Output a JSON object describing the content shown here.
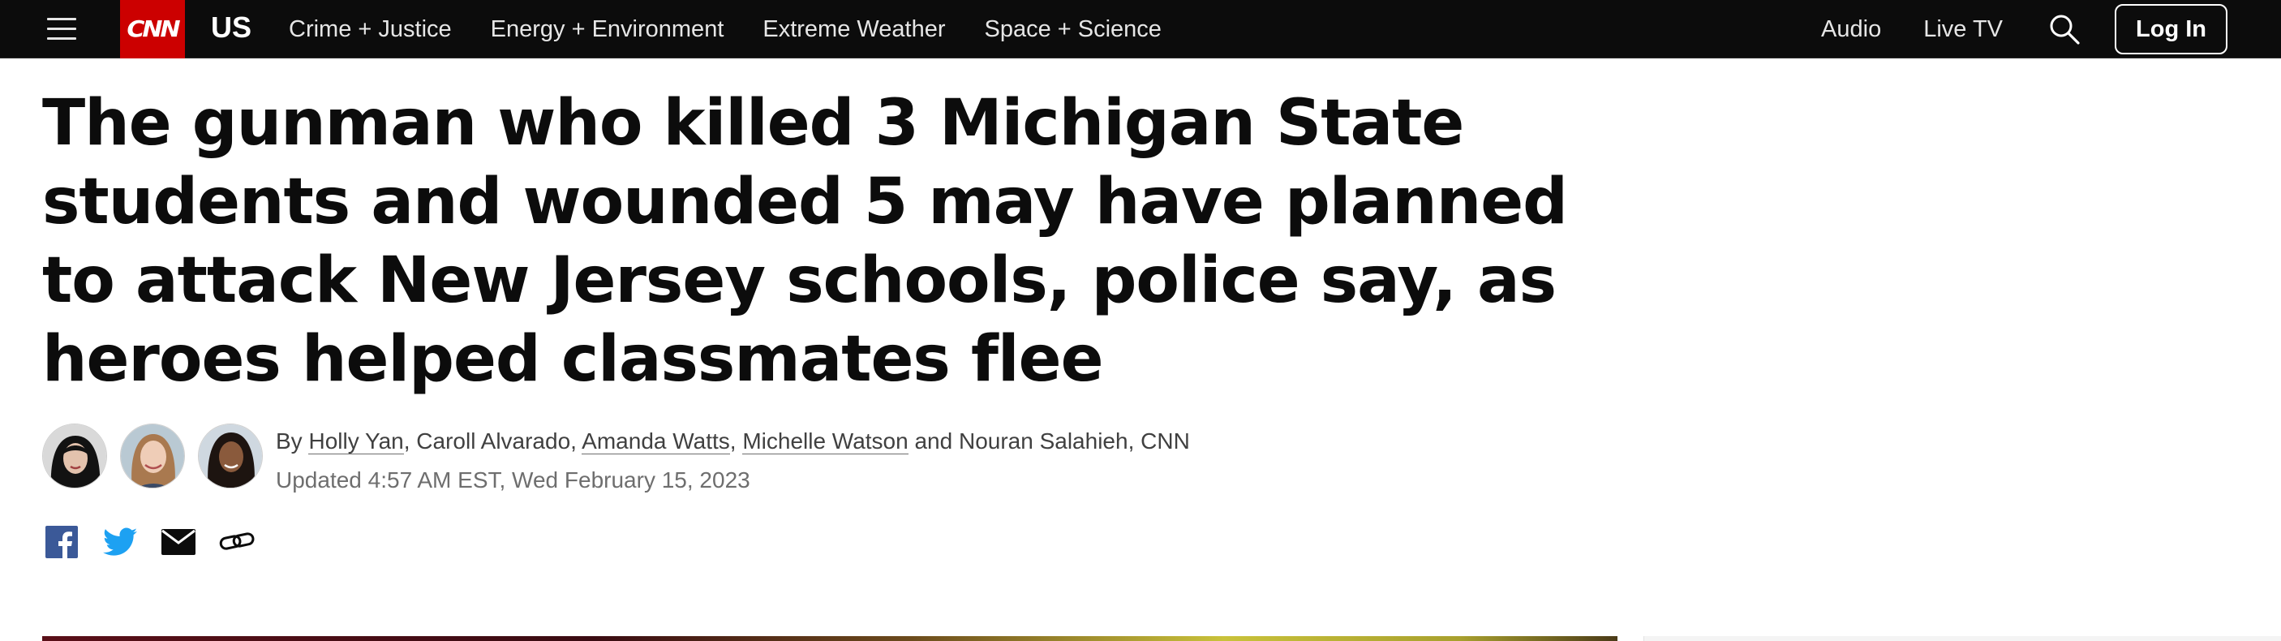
{
  "nav": {
    "logo": "CNN",
    "section": "US",
    "links": [
      "Crime + Justice",
      "Energy + Environment",
      "Extreme Weather",
      "Space + Science"
    ],
    "audio": "Audio",
    "live_tv": "Live TV",
    "login": "Log In",
    "icons": {
      "menu": "hamburger-menu-icon",
      "search": "magnifier-icon"
    },
    "colors": {
      "bar": "#0c0c0c",
      "logo": "#cc0000"
    }
  },
  "article": {
    "headline": "The gunman who killed 3 Michigan State students and wounded 5 may have planned to attack New Jersey schools, police say, as heroes helped classmates flee",
    "byline": {
      "by": "By",
      "author_1": "Holly Yan",
      "sep_1": ", Caroll Alvarado, ",
      "author_2": "Amanda Watts",
      "sep_2": ", ",
      "author_3": "Michelle Watson",
      "rest": " and Nouran Salahieh, CNN"
    },
    "updated": "Updated 4:57 AM EST, Wed February 15, 2023"
  },
  "share": {
    "icons": [
      "facebook-icon",
      "twitter-icon",
      "email-icon",
      "link-icon"
    ],
    "colors": {
      "facebook": "#3b5998",
      "twitter": "#1da1f2",
      "email": "#0c0c0c",
      "link": "#0c0c0c"
    }
  }
}
